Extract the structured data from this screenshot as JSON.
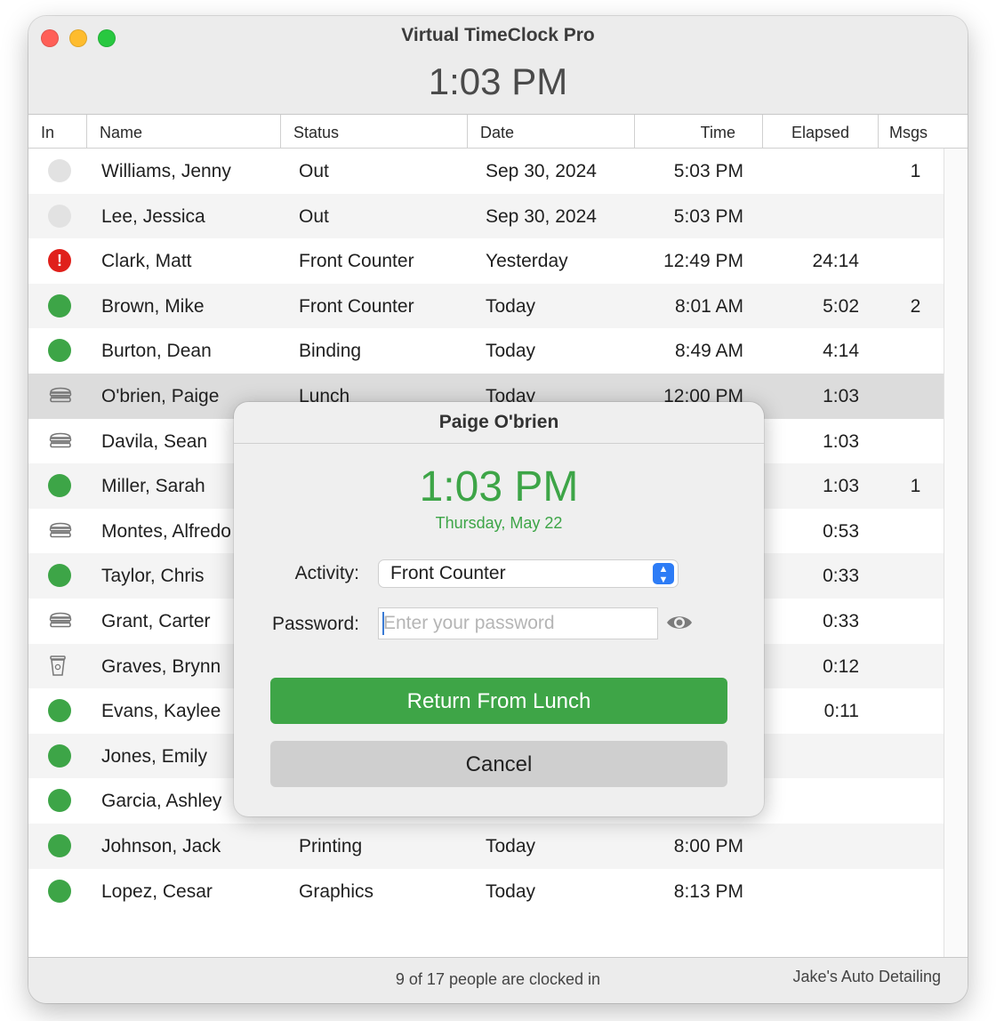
{
  "window": {
    "title": "Virtual TimeClock Pro",
    "clock": "1:03 PM"
  },
  "table": {
    "columns": [
      "In",
      "Name",
      "Status",
      "Date",
      "Time",
      "Elapsed",
      "Msgs"
    ],
    "rows": [
      {
        "state": "out",
        "name": "Williams, Jenny",
        "status": "Out",
        "date": "Sep 30, 2024",
        "time": "5:03 PM",
        "elapsed": "",
        "msgs": "1"
      },
      {
        "state": "out",
        "name": "Lee, Jessica",
        "status": "Out",
        "date": "Sep 30, 2024",
        "time": "5:03 PM",
        "elapsed": "",
        "msgs": ""
      },
      {
        "state": "alert",
        "name": "Clark, Matt",
        "status": "Front Counter",
        "date": "Yesterday",
        "time": "12:49 PM",
        "elapsed": "24:14",
        "msgs": ""
      },
      {
        "state": "in",
        "name": "Brown, Mike",
        "status": "Front Counter",
        "date": "Today",
        "time": "8:01 AM",
        "elapsed": "5:02",
        "msgs": "2"
      },
      {
        "state": "in",
        "name": "Burton, Dean",
        "status": "Binding",
        "date": "Today",
        "time": "8:49 AM",
        "elapsed": "4:14",
        "msgs": ""
      },
      {
        "state": "lunch",
        "name": "O'brien, Paige",
        "status": "Lunch",
        "date": "Today",
        "time": "12:00 PM",
        "elapsed": "1:03",
        "msgs": ""
      },
      {
        "state": "lunch",
        "name": "Davila, Sean",
        "status": "",
        "date": "",
        "time": "",
        "elapsed": "1:03",
        "msgs": ""
      },
      {
        "state": "in",
        "name": "Miller, Sarah",
        "status": "",
        "date": "",
        "time": "",
        "elapsed": "1:03",
        "msgs": "1"
      },
      {
        "state": "lunch",
        "name": "Montes, Alfredo",
        "status": "",
        "date": "",
        "time": "",
        "elapsed": "0:53",
        "msgs": ""
      },
      {
        "state": "in",
        "name": "Taylor, Chris",
        "status": "",
        "date": "",
        "time": "",
        "elapsed": "0:33",
        "msgs": ""
      },
      {
        "state": "lunch",
        "name": "Grant, Carter",
        "status": "",
        "date": "",
        "time": "",
        "elapsed": "0:33",
        "msgs": ""
      },
      {
        "state": "break",
        "name": "Graves, Brynn",
        "status": "",
        "date": "",
        "time": "",
        "elapsed": "0:12",
        "msgs": ""
      },
      {
        "state": "in",
        "name": "Evans, Kaylee",
        "status": "",
        "date": "",
        "time": "",
        "elapsed": "0:11",
        "msgs": ""
      },
      {
        "state": "in",
        "name": "Jones, Emily",
        "status": "",
        "date": "",
        "time": "",
        "elapsed": "",
        "msgs": ""
      },
      {
        "state": "in",
        "name": "Garcia, Ashley",
        "status": "",
        "date": "",
        "time": "",
        "elapsed": "",
        "msgs": ""
      },
      {
        "state": "in",
        "name": "Johnson, Jack",
        "status": "Printing",
        "date": "Today",
        "time": "8:00 PM",
        "elapsed": "",
        "msgs": ""
      },
      {
        "state": "in",
        "name": "Lopez, Cesar",
        "status": "Graphics",
        "date": "Today",
        "time": "8:13 PM",
        "elapsed": "",
        "msgs": ""
      }
    ],
    "selected_index": 5
  },
  "footer": {
    "status": "9 of 17 people are clocked in",
    "company": "Jake's Auto Detailing"
  },
  "sheet": {
    "title": "Paige O'brien",
    "time": "1:03 PM",
    "date": "Thursday, May 22",
    "activity_label": "Activity:",
    "activity_value": "Front Counter",
    "password_label": "Password:",
    "password_placeholder": "Enter your password",
    "password_value": "",
    "primary_button": "Return From Lunch",
    "cancel_button": "Cancel"
  },
  "colors": {
    "accent_green": "#3da547",
    "alert_red": "#e0201b",
    "select_blue": "#2d7cf6"
  }
}
